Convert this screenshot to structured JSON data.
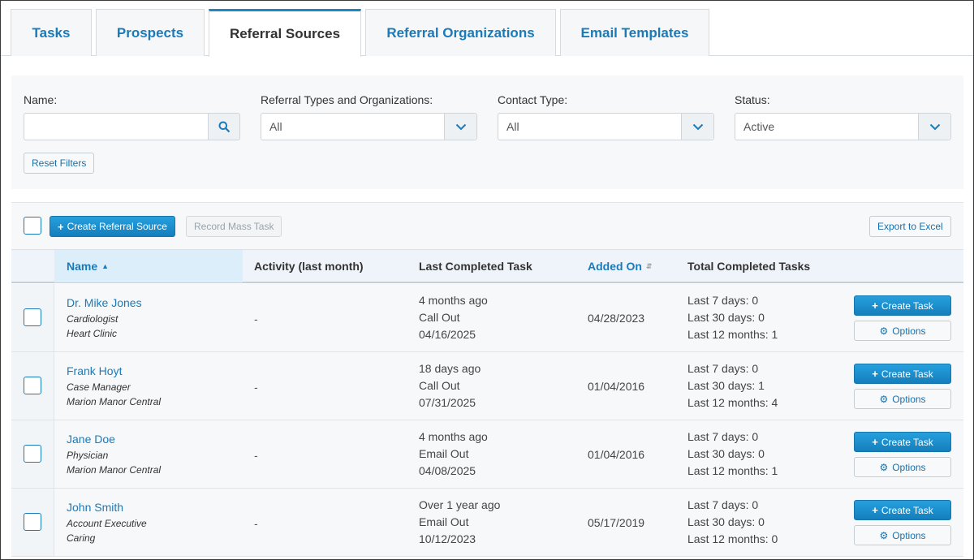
{
  "tabs": [
    {
      "label": "Tasks",
      "active": false
    },
    {
      "label": "Prospects",
      "active": false
    },
    {
      "label": "Referral Sources",
      "active": true
    },
    {
      "label": "Referral Organizations",
      "active": false
    },
    {
      "label": "Email Templates",
      "active": false
    }
  ],
  "filters": {
    "name_label": "Name:",
    "name_value": "",
    "types_label": "Referral Types and Organizations:",
    "types_value": "All",
    "contact_label": "Contact Type:",
    "contact_value": "All",
    "status_label": "Status:",
    "status_value": "Active",
    "reset_label": "Reset Filters"
  },
  "toolbar": {
    "create_label": "Create Referral Source",
    "mass_task_label": "Record Mass Task",
    "export_label": "Export to Excel"
  },
  "table": {
    "headers": {
      "name": "Name",
      "activity": "Activity (last month)",
      "last_task": "Last Completed Task",
      "added_on": "Added On",
      "total_tasks": "Total Completed Tasks"
    },
    "create_task_label": "Create Task",
    "options_label": "Options",
    "rows": [
      {
        "name": "Dr. Mike Jones",
        "role": "Cardiologist",
        "org": "Heart Clinic",
        "activity": "-",
        "last_ago": "4 months ago",
        "last_type": "Call Out",
        "last_date": "04/16/2025",
        "added_on": "04/28/2023",
        "last7": "Last 7 days: 0",
        "last30": "Last 30 days: 0",
        "last12": "Last 12 months: 1"
      },
      {
        "name": "Frank Hoyt",
        "role": "Case Manager",
        "org": "Marion Manor Central",
        "activity": "-",
        "last_ago": "18 days ago",
        "last_type": "Call Out",
        "last_date": "07/31/2025",
        "added_on": "01/04/2016",
        "last7": "Last 7 days: 0",
        "last30": "Last 30 days: 1",
        "last12": "Last 12 months: 4"
      },
      {
        "name": "Jane Doe",
        "role": "Physician",
        "org": "Marion Manor Central",
        "activity": "-",
        "last_ago": "4 months ago",
        "last_type": "Email Out",
        "last_date": "04/08/2025",
        "added_on": "01/04/2016",
        "last7": "Last 7 days: 0",
        "last30": "Last 30 days: 0",
        "last12": "Last 12 months: 1"
      },
      {
        "name": "John Smith",
        "role": "Account Executive",
        "org": "Caring",
        "activity": "-",
        "last_ago": "Over 1 year ago",
        "last_type": "Email Out",
        "last_date": "10/12/2023",
        "added_on": "05/17/2019",
        "last7": "Last 7 days: 0",
        "last30": "Last 30 days: 0",
        "last12": "Last 12 months: 0"
      }
    ]
  },
  "colors": {
    "accent": "#1b7ab8",
    "primary_button": "#1a8fd0"
  }
}
